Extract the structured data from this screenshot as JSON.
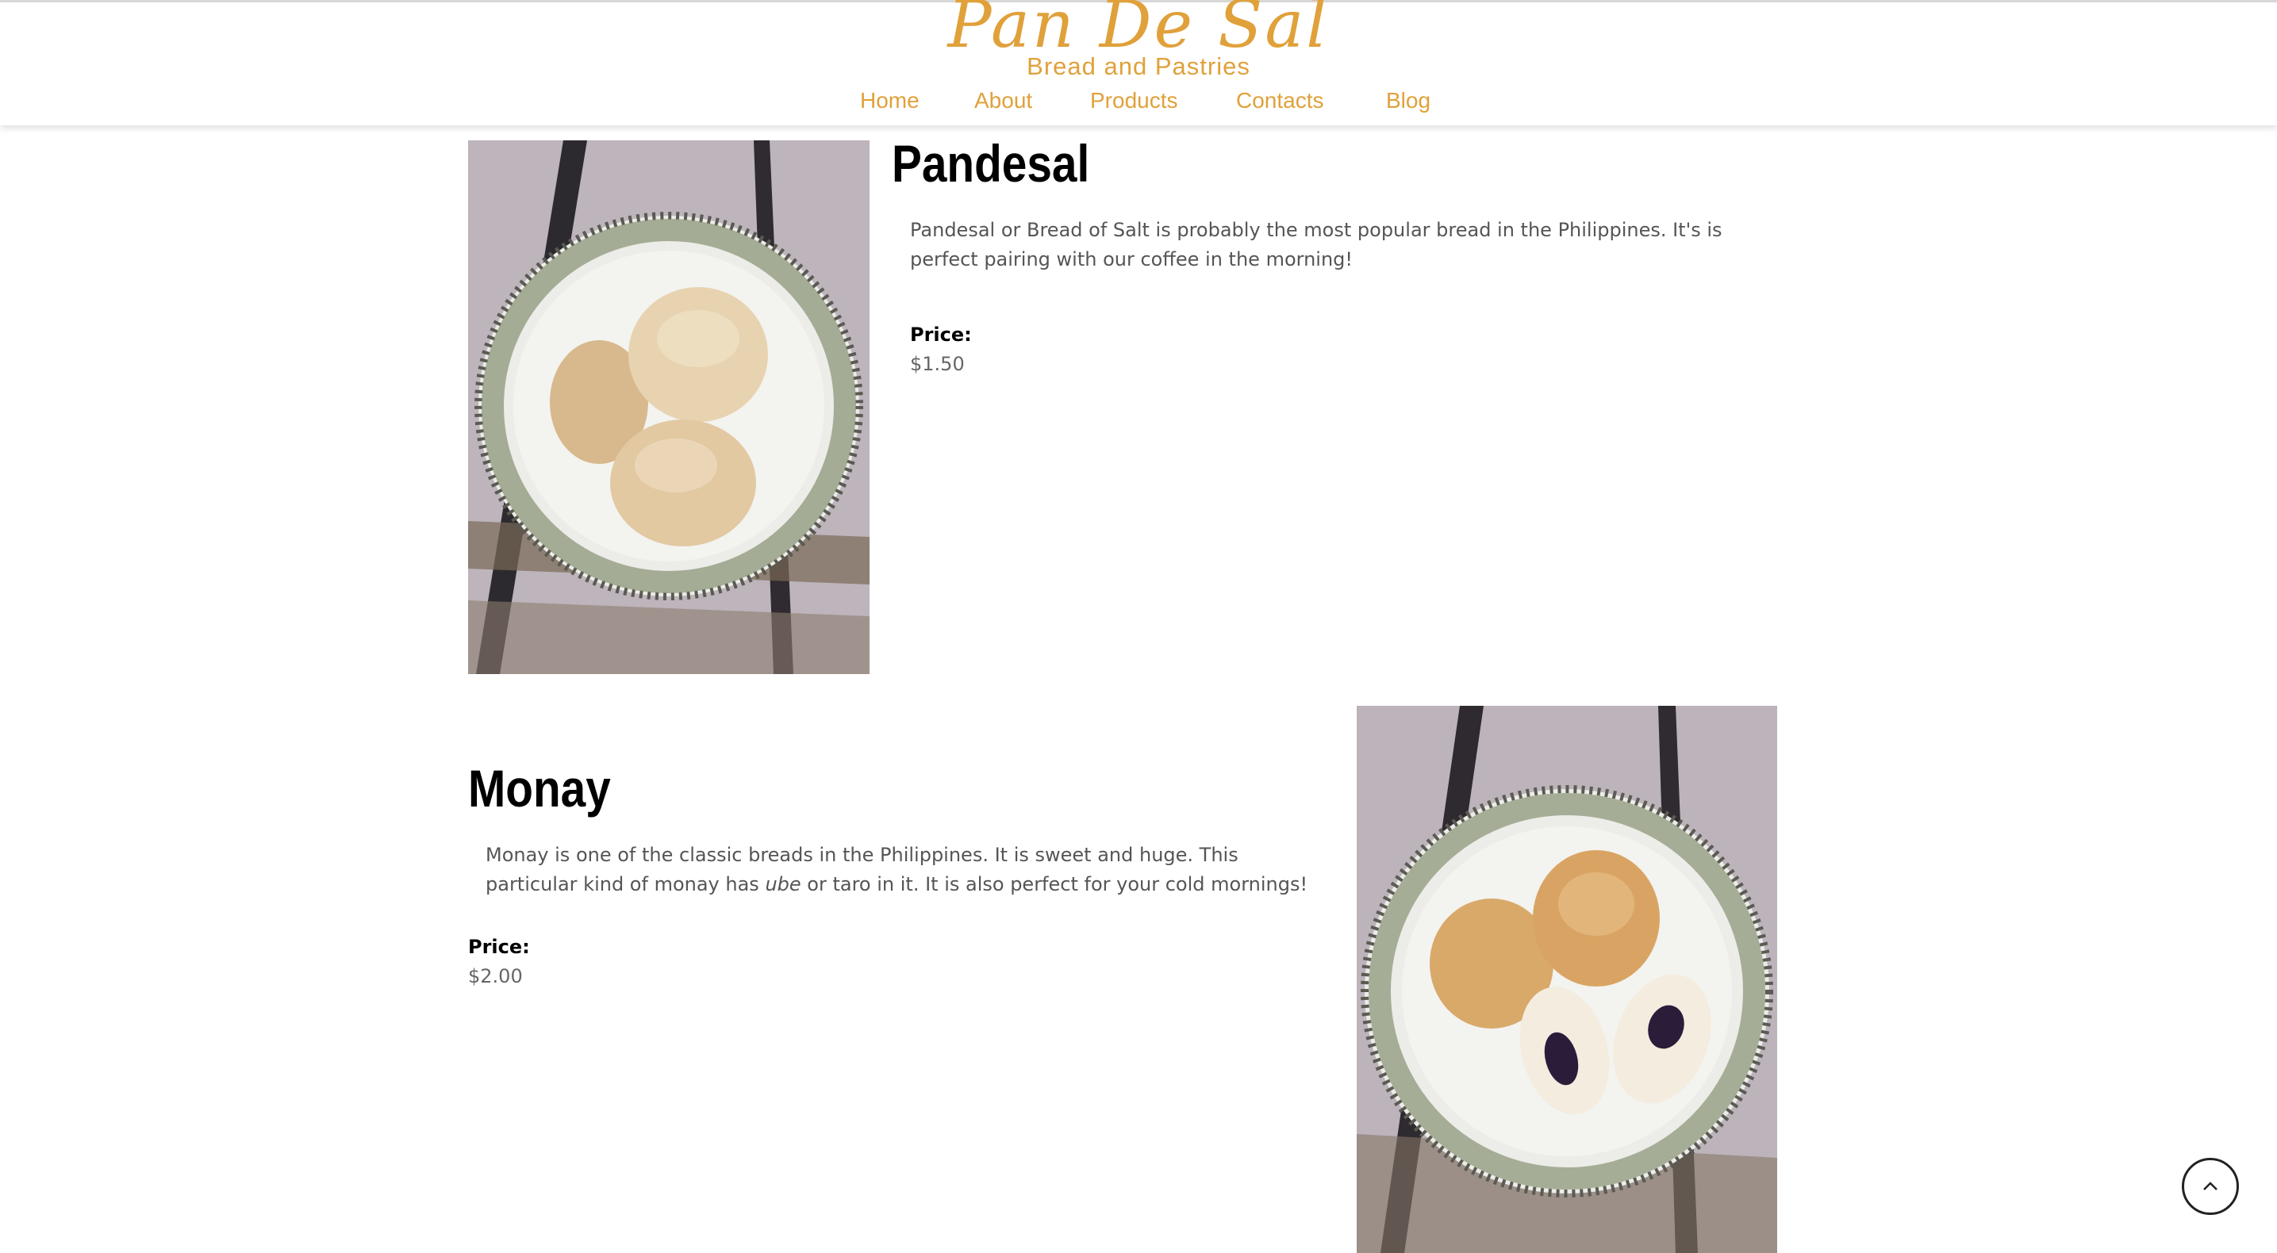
{
  "site": {
    "logo_title": "Pan De Sal",
    "logo_subtitle": "Bread and Pastries",
    "accent_color": "#e0a13a"
  },
  "nav": {
    "items": [
      {
        "label": "Home"
      },
      {
        "label": "About"
      },
      {
        "label": "Products"
      },
      {
        "label": "Contacts"
      },
      {
        "label": "Blog"
      }
    ]
  },
  "products": [
    {
      "title": "Pandesal",
      "description": "Pandesal or Bread of Salt is probably the most popular bread in the Philippines. It's is perfect pairing with our coffee in the morning!",
      "price_label": "Price:",
      "price": "$1.50",
      "image_icon": "plate-of-bread-image"
    },
    {
      "title": "Monay",
      "description_before": "Monay is one of the classic breads in the Philippines. It is sweet and huge. This particular kind of monay has ",
      "description_italic": "ube",
      "description_after": " or taro in it. It is also perfect for your cold mornings!",
      "price_label": "Price:",
      "price": "$2.00",
      "image_icon": "plate-of-monay-image"
    }
  ],
  "scroll_top": {
    "icon": "chevron-up-icon"
  }
}
